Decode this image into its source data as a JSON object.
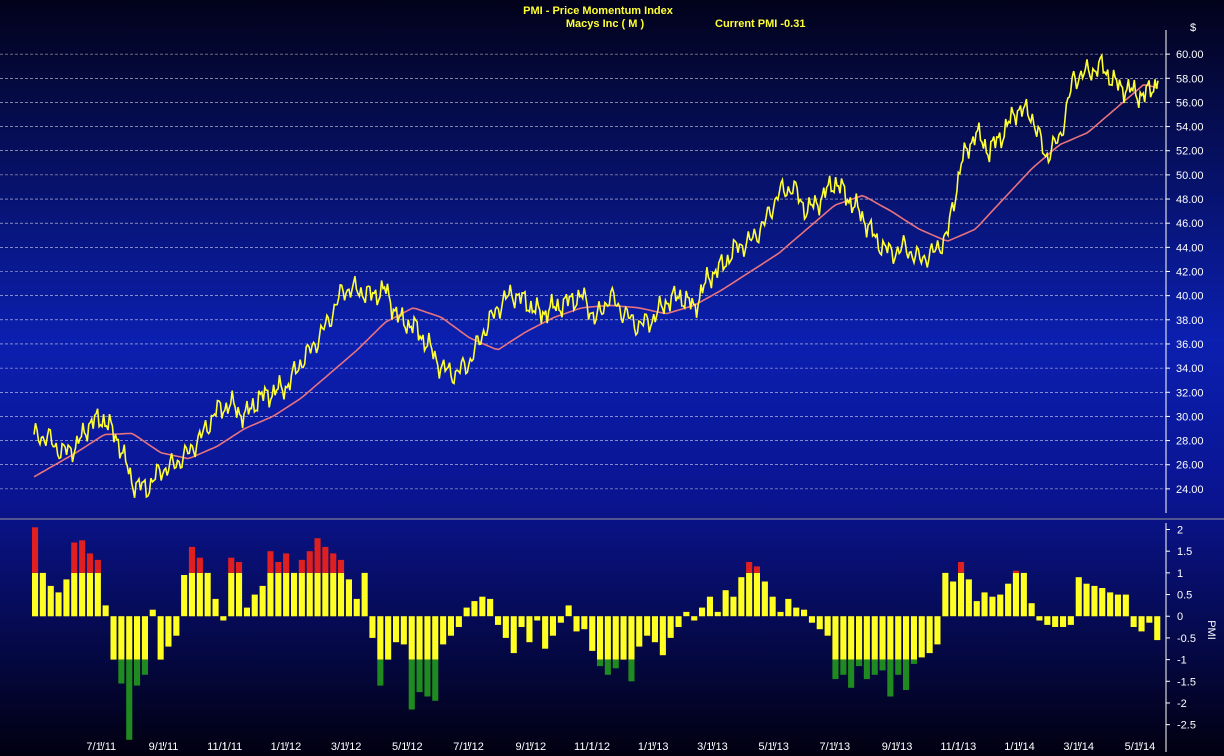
{
  "header": {
    "title": "PMI - Price Momentum Index",
    "symbol": "Macys Inc ( M )",
    "current": "Current PMI -0.31"
  },
  "chart_data": [
    {
      "type": "line",
      "yunit": "$",
      "ylim": [
        22.5,
        61.5
      ],
      "yticks": [
        24,
        26,
        28,
        30,
        32,
        34,
        36,
        38,
        40,
        42,
        44,
        46,
        48,
        50,
        52,
        54,
        56,
        58,
        60
      ],
      "ytick_labels": [
        "24.00",
        "26.00",
        "28.00",
        "30.00",
        "32.00",
        "34.00",
        "36.00",
        "38.00",
        "40.00",
        "42.00",
        "44.00",
        "46.00",
        "48.00",
        "50.00",
        "52.00",
        "54.00",
        "56.00",
        "58.00",
        "60.00"
      ],
      "grid": true,
      "series": [
        {
          "role": "price",
          "color": "#ffff33",
          "x": [
            "2011-04-25",
            "2011-05-09",
            "2011-05-23",
            "2011-06-06",
            "2011-06-20",
            "2011-07-04",
            "2011-07-18",
            "2011-08-01",
            "2011-08-15",
            "2011-08-29",
            "2011-09-12",
            "2011-09-26",
            "2011-10-10",
            "2011-10-24",
            "2011-11-07",
            "2011-11-21",
            "2011-12-05",
            "2011-12-19",
            "2012-01-02",
            "2012-01-16",
            "2012-01-30",
            "2012-02-13",
            "2012-02-27",
            "2012-03-12",
            "2012-03-26",
            "2012-04-09",
            "2012-04-23",
            "2012-05-07",
            "2012-05-21",
            "2012-06-04",
            "2012-06-18",
            "2012-07-02",
            "2012-07-16",
            "2012-07-30",
            "2012-08-13",
            "2012-08-27",
            "2012-09-10",
            "2012-09-24",
            "2012-10-08",
            "2012-10-22",
            "2012-11-05",
            "2012-11-19",
            "2012-12-03",
            "2012-12-17",
            "2012-12-31",
            "2013-01-14",
            "2013-01-28",
            "2013-02-11",
            "2013-02-25",
            "2013-03-11",
            "2013-03-25",
            "2013-04-08",
            "2013-04-22",
            "2013-05-06",
            "2013-05-20",
            "2013-06-03",
            "2013-06-17",
            "2013-07-01",
            "2013-07-15",
            "2013-07-29",
            "2013-08-12",
            "2013-08-26",
            "2013-09-09",
            "2013-09-23",
            "2013-10-07",
            "2013-10-21",
            "2013-11-04",
            "2013-11-18",
            "2013-12-02",
            "2013-12-16",
            "2013-12-30",
            "2014-01-13",
            "2014-01-27",
            "2014-02-10",
            "2014-02-24",
            "2014-03-10",
            "2014-03-24",
            "2014-04-07",
            "2014-04-21",
            "2014-05-05",
            "2014-05-19"
          ],
          "values": [
            28.5,
            28.2,
            27.0,
            27.5,
            29.5,
            29.8,
            28.0,
            24.5,
            24.0,
            25.5,
            26.0,
            27.0,
            28.5,
            30.5,
            31.0,
            30.0,
            31.5,
            32.0,
            32.5,
            34.5,
            36.0,
            38.0,
            40.5,
            40.5,
            40.0,
            40.5,
            38.0,
            37.5,
            36.0,
            34.0,
            33.5,
            34.5,
            37.0,
            39.0,
            40.2,
            39.5,
            38.5,
            39.0,
            39.5,
            40.0,
            38.0,
            40.0,
            38.5,
            37.5,
            38.0,
            39.5,
            40.0,
            39.0,
            41.5,
            42.5,
            44.0,
            44.5,
            46.0,
            48.5,
            49.0,
            47.0,
            48.0,
            49.5,
            48.0,
            46.5,
            44.5,
            43.5,
            44.0,
            43.0,
            43.5,
            45.0,
            51.0,
            53.5,
            52.0,
            53.5,
            55.5,
            55.0,
            51.5,
            53.0,
            58.0,
            58.5,
            59.0,
            57.5,
            57.0,
            56.5,
            57.8
          ]
        },
        {
          "role": "moving-average",
          "color": "#e8737f",
          "x": [
            "2011-04-25",
            "2011-06-06",
            "2011-07-04",
            "2011-08-01",
            "2011-08-29",
            "2011-09-26",
            "2011-10-24",
            "2011-11-21",
            "2011-12-19",
            "2012-01-16",
            "2012-02-13",
            "2012-03-12",
            "2012-04-09",
            "2012-05-07",
            "2012-06-04",
            "2012-07-02",
            "2012-07-30",
            "2012-08-27",
            "2012-09-24",
            "2012-10-22",
            "2012-11-19",
            "2012-12-17",
            "2013-01-14",
            "2013-02-11",
            "2013-03-11",
            "2013-04-08",
            "2013-05-06",
            "2013-06-03",
            "2013-07-01",
            "2013-07-29",
            "2013-08-26",
            "2013-09-23",
            "2013-10-21",
            "2013-11-18",
            "2013-12-16",
            "2014-01-13",
            "2014-02-10",
            "2014-03-10",
            "2014-04-07",
            "2014-05-05",
            "2014-05-19"
          ],
          "values": [
            25.0,
            27.0,
            28.5,
            28.6,
            27.0,
            26.5,
            27.5,
            29.0,
            30.0,
            31.5,
            33.5,
            35.5,
            37.8,
            39.0,
            38.2,
            36.5,
            35.5,
            37.0,
            38.2,
            39.0,
            39.2,
            39.0,
            38.5,
            39.2,
            40.5,
            42.0,
            43.5,
            45.5,
            47.5,
            48.3,
            47.0,
            45.5,
            44.5,
            45.5,
            48.0,
            50.5,
            52.5,
            53.5,
            55.5,
            57.5,
            57.2
          ]
        }
      ]
    },
    {
      "type": "bar",
      "ylabel": "PMI",
      "ylim": [
        -2.9,
        2.15
      ],
      "yticks": [
        2,
        1.5,
        1,
        0.5,
        0,
        -0.5,
        -1,
        -1.5,
        -2,
        -2.5
      ],
      "ytick_labels": [
        "2",
        "1.5",
        "1",
        "0.5",
        "0",
        "-0.5",
        "-1",
        "-1.5",
        "-2",
        "-2.5"
      ],
      "threshold": 1,
      "colors": {
        "base": "#ffff22",
        "above": "#e02020",
        "below": "#1f8a1f"
      },
      "values": [
        2.05,
        1.0,
        0.7,
        0.55,
        0.85,
        1.7,
        1.75,
        1.45,
        1.3,
        0.25,
        -1.0,
        -1.55,
        -2.85,
        -1.6,
        -1.35,
        0.15,
        -1.0,
        -0.7,
        -0.45,
        0.95,
        1.6,
        1.35,
        1.0,
        0.4,
        -0.1,
        1.35,
        1.25,
        0.2,
        0.5,
        0.7,
        1.5,
        1.25,
        1.45,
        1.0,
        1.3,
        1.5,
        1.8,
        1.6,
        1.45,
        1.3,
        0.85,
        0.4,
        1.0,
        -0.5,
        -1.6,
        -1.0,
        -0.6,
        -0.65,
        -2.15,
        -1.75,
        -1.85,
        -1.95,
        -0.65,
        -0.45,
        -0.25,
        0.2,
        0.35,
        0.45,
        0.4,
        -0.2,
        -0.5,
        -0.85,
        -0.25,
        -0.6,
        -0.1,
        -0.75,
        -0.45,
        -0.15,
        0.25,
        -0.35,
        -0.3,
        -0.8,
        -1.15,
        -1.35,
        -1.2,
        -1.0,
        -1.5,
        -0.7,
        -0.45,
        -0.6,
        -0.9,
        -0.5,
        -0.25,
        0.1,
        -0.1,
        0.2,
        0.45,
        0.1,
        0.6,
        0.45,
        0.9,
        1.25,
        1.15,
        0.8,
        0.45,
        0.1,
        0.4,
        0.2,
        0.15,
        -0.15,
        -0.3,
        -0.45,
        -1.45,
        -1.35,
        -1.65,
        -1.15,
        -1.45,
        -1.35,
        -1.25,
        -1.85,
        -1.35,
        -1.7,
        -1.1,
        -0.95,
        -0.85,
        -0.65,
        1.0,
        0.8,
        1.25,
        0.85,
        0.35,
        0.55,
        0.45,
        0.5,
        0.75,
        1.05,
        1.0,
        0.3,
        -0.1,
        -0.2,
        -0.25,
        -0.25,
        -0.2,
        0.9,
        0.75,
        0.7,
        0.65,
        0.55,
        0.5,
        0.5,
        -0.25,
        -0.35,
        -0.15,
        -0.55
      ]
    }
  ],
  "x_axis": {
    "ticks": [
      "2011-07-01",
      "2011-09-01",
      "2011-11-01",
      "2012-01-01",
      "2012-03-01",
      "2012-05-01",
      "2012-07-01",
      "2012-09-01",
      "2012-11-01",
      "2013-01-01",
      "2013-03-01",
      "2013-05-01",
      "2013-07-01",
      "2013-09-01",
      "2013-11-01",
      "2014-01-01",
      "2014-03-01",
      "2014-05-01"
    ],
    "tick_labels": [
      "7/1/11",
      "9/1/11",
      "11/1/11",
      "1/1/12",
      "3/1/12",
      "5/1/12",
      "7/1/12",
      "9/1/12",
      "11/1/12",
      "1/1/13",
      "3/1/13",
      "5/1/13",
      "7/1/13",
      "9/1/13",
      "11/1/13",
      "1/1/14",
      "3/1/14",
      "5/1/14"
    ]
  }
}
